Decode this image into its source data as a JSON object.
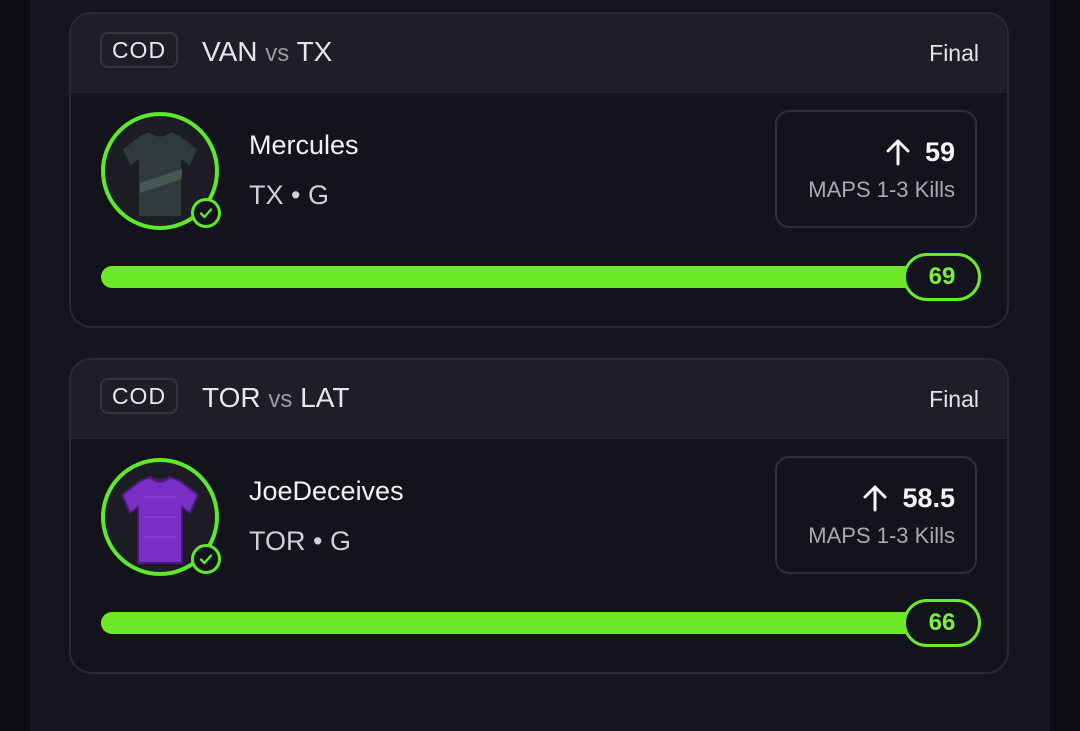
{
  "cards": [
    {
      "league": "COD",
      "home": "VAN",
      "vs": "vs",
      "away": "TX",
      "status": "Final",
      "player": {
        "name": "Mercules",
        "team_position": "TX • G",
        "jersey_color": "#2f3a3a"
      },
      "line": {
        "direction": "up-arrow-icon",
        "value": "59",
        "stat": "MAPS 1-3 Kills"
      },
      "result": {
        "value": "69",
        "progress_fraction": 1.0
      }
    },
    {
      "league": "COD",
      "home": "TOR",
      "vs": "vs",
      "away": "LAT",
      "status": "Final",
      "player": {
        "name": "JoeDeceives",
        "team_position": "TOR • G",
        "jersey_color": "#7a2fc4"
      },
      "line": {
        "direction": "up-arrow-icon",
        "value": "58.5",
        "stat": "MAPS 1-3 Kills"
      },
      "result": {
        "value": "66",
        "progress_fraction": 1.0
      }
    }
  ],
  "colors": {
    "accent": "#6ee927",
    "background": "#0c0c12",
    "card": "#13131b",
    "header": "#1e1e29"
  }
}
